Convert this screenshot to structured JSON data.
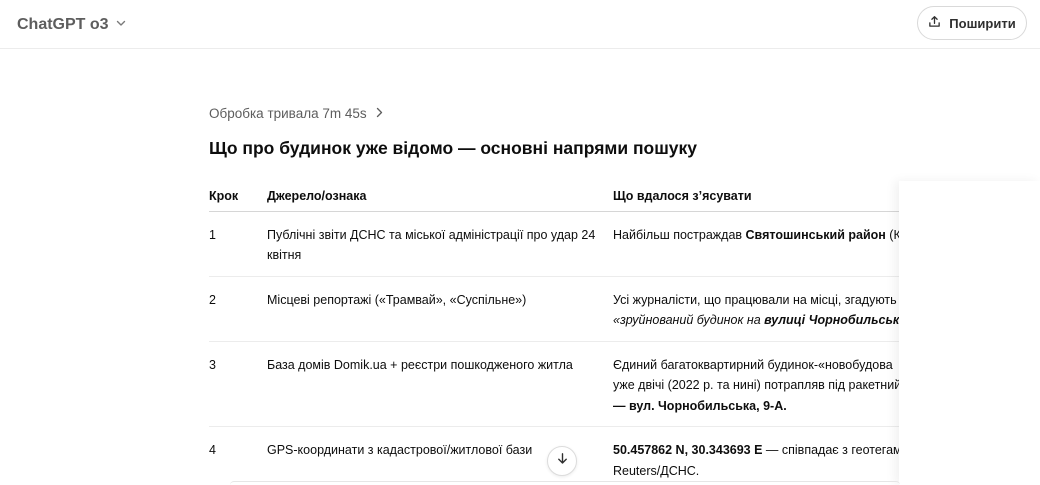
{
  "header": {
    "model_name": "ChatGPT o3",
    "share_label": "Поширити"
  },
  "message": {
    "thinking_label": "Обробка тривала 7m 45s",
    "heading": "Що про будинок уже відомо — основні напрями пошуку"
  },
  "table": {
    "headers": [
      "Крок",
      "Джерело/ознака",
      "Що вдалося з’ясувати"
    ],
    "rows": [
      {
        "step": "1",
        "source": "Публічні звіти ДСНС та міської адміністрації про удар 24 квітня",
        "finding_pre": "Найбільш постраждав ",
        "finding_bold": "Святошинський район",
        "finding_post": " (Ки"
      },
      {
        "step": "2",
        "source": "Місцеві репортажі («Трамвай», «Суспільне»)",
        "finding_line1": "Усі журналісти, що працювали на місці, згадують",
        "finding_italic_pre": "«зруйнований будинок на ",
        "finding_italic_bold": "вулиці Чорнобильській"
      },
      {
        "step": "3",
        "source": "База домів Domik.ua + реєстри пошкодженого житла",
        "finding_line1": "Єдиний багатоквартирний будинок-«новобудова",
        "finding_line2": "уже двічі (2022 р. та нині) потрапляв під ракетний",
        "finding_bold": "— вул. Чорнобильська, 9-А."
      },
      {
        "step": "4",
        "source": "GPS-координати з кадастрової/житлової бази",
        "finding_bold": "50.457862 N, 30.343693 E",
        "finding_post": " — співпадає з геотегами",
        "finding_line2": "Reuters/ДСНС."
      }
    ]
  },
  "icons": {
    "model_chevron": "chevron-down-icon",
    "share": "share-icon",
    "thinking_chevron": "chevron-right-icon",
    "scroll": "arrow-down-icon"
  }
}
